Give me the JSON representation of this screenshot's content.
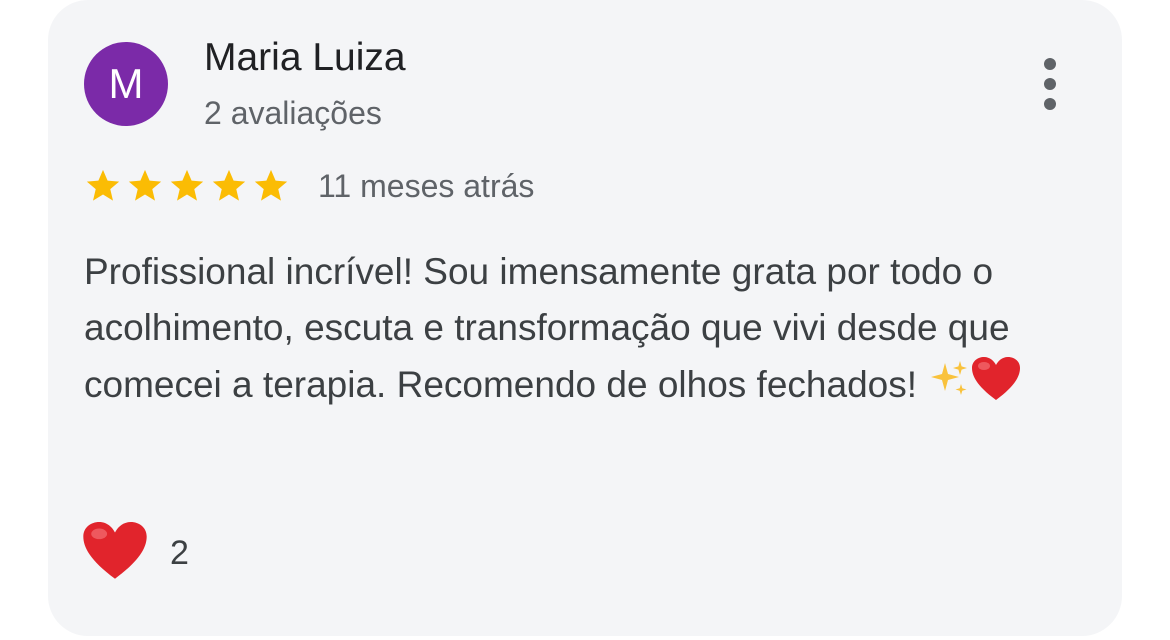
{
  "review": {
    "author": {
      "initial": "M",
      "name": "Maria Luiza",
      "reviews_count": "2 avaliações",
      "avatar_color": "#7b2aa8"
    },
    "rating": {
      "stars": 5,
      "max_stars": 5,
      "star_color": "#fbbc04"
    },
    "date": "11 meses atrás",
    "text": "Profissional incrível! Sou imensamente grata por todo o acolhimento, escuta e transformação que vivi desde que comecei a terapia. Recomendo de olhos fechados!",
    "text_emojis": [
      "sparkles-icon",
      "red-heart-icon"
    ],
    "reaction": {
      "icon": "red-heart-icon",
      "count": "2"
    },
    "menu_icon": "more-vert-icon"
  }
}
